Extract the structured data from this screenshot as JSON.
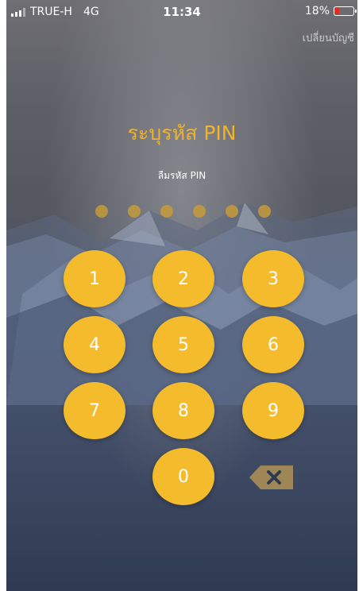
{
  "status_bar": {
    "carrier": "TRUE-H",
    "network": "4G",
    "time": "11:34",
    "battery": "18%",
    "battery_level_pct": 18
  },
  "header": {
    "switch_account": "เปลี่ยนบัญชี"
  },
  "pin": {
    "title": "ระบุรหัส PIN",
    "forgot": "ลืมรหัส PIN",
    "length": 6,
    "entered": 0
  },
  "keypad": {
    "keys": [
      "1",
      "2",
      "3",
      "4",
      "5",
      "6",
      "7",
      "8",
      "9",
      "0"
    ],
    "backspace_icon": "backspace-icon"
  },
  "colors": {
    "accent": "#f4bb2c",
    "title": "#f0b32a",
    "dot": "#c69a3a",
    "battery_low": "#e8281f"
  }
}
